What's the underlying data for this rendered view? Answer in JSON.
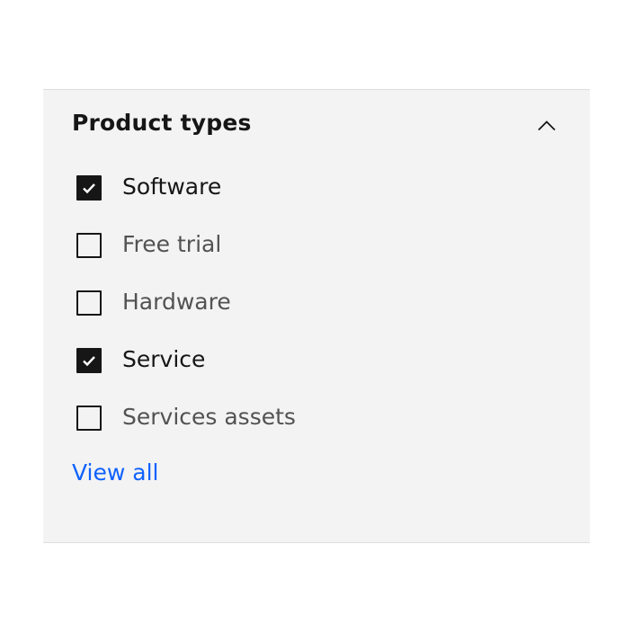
{
  "filter": {
    "title": "Product types",
    "collapse_icon": "chevron-up-icon",
    "options": [
      {
        "label": "Software",
        "checked": true
      },
      {
        "label": "Free trial",
        "checked": false
      },
      {
        "label": "Hardware",
        "checked": false
      },
      {
        "label": "Service",
        "checked": true
      },
      {
        "label": "Services assets",
        "checked": false
      }
    ],
    "view_all_label": "View all"
  },
  "colors": {
    "panel_background": "#f3f3f3",
    "checkbox": "#161616",
    "link": "#0f62fe"
  }
}
